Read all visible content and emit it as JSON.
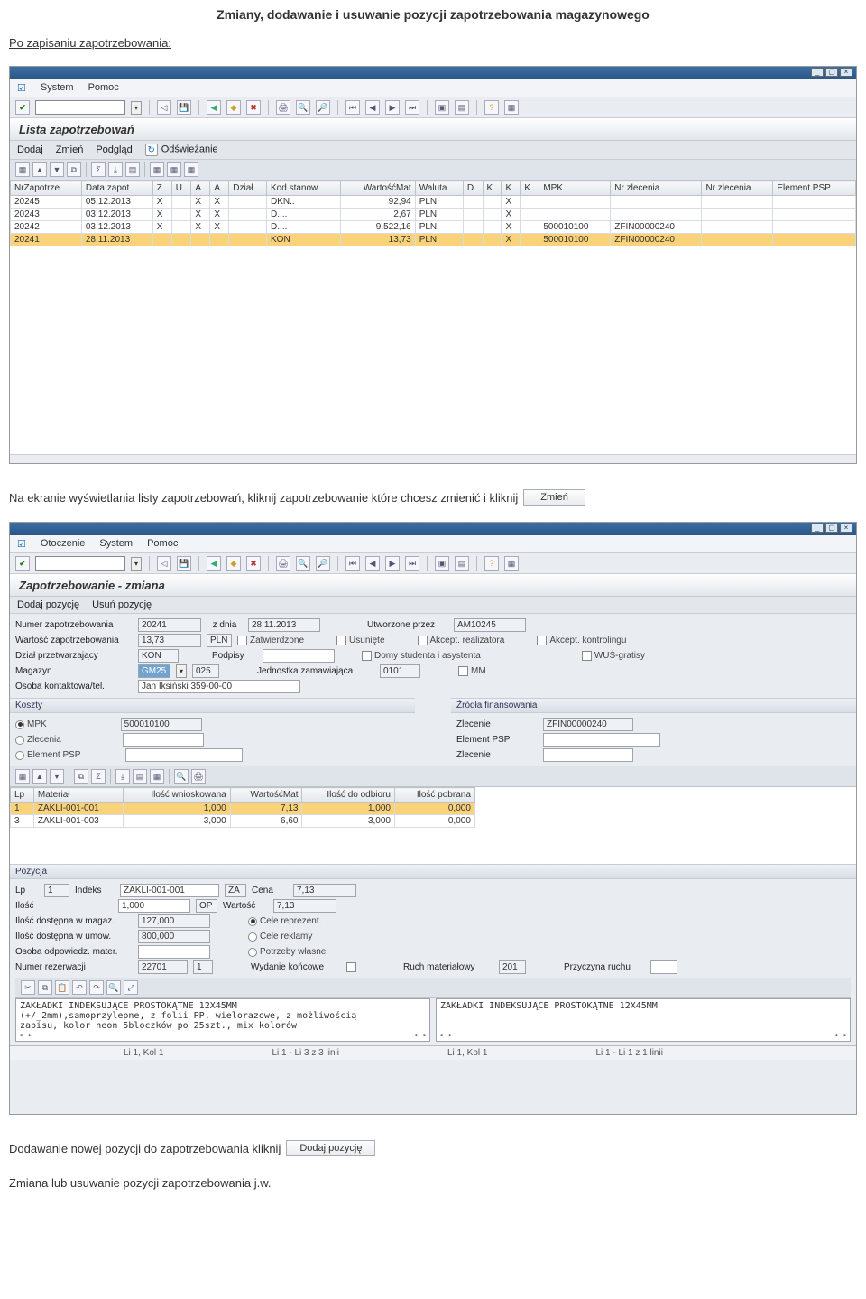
{
  "doc": {
    "title": "Zmiany, dodawanie i usuwanie pozycji zapotrzebowania magazynowego",
    "after_save": "Po zapisaniu zapotrzebowania:",
    "instr1": "Na ekranie wyświetlania listy zapotrzebowań, kliknij zapotrzebowanie które chcesz zmienić i kliknij",
    "zmien_btn": "Zmień",
    "instr2": "Dodawanie nowej pozycji do zapotrzebowania kliknij",
    "dodaj_btn": "Dodaj pozycję",
    "instr3": "Zmiana lub usuwanie pozycji zapotrzebowania j.w."
  },
  "sap1": {
    "menu": [
      "System",
      "Pomoc"
    ],
    "title": "Lista zapotrzebowań",
    "toolbar": [
      "Dodaj",
      "Zmień",
      "Podgląd",
      "Odświeżanie"
    ],
    "cols": [
      "NrZapotrze",
      "Data zapot",
      "Z",
      "U",
      "A",
      "A",
      "Dział",
      "Kod stanow",
      "WartośćMat",
      "Waluta",
      "D",
      "K",
      "K",
      "K",
      "MPK",
      "Nr zlecenia",
      "Nr zlecenia",
      "Element PSP"
    ],
    "rows": [
      {
        "nr": "20245",
        "data": "05.12.2013",
        "z": "X",
        "u": "",
        "a1": "X",
        "a2": "X",
        "dzial": "",
        "kod": "DKN..",
        "wart": "92,94",
        "wal": "PLN",
        "d": "",
        "k1": "",
        "k2": "X",
        "k3": "",
        "mpk": "",
        "zl1": "",
        "zl2": "",
        "psp": ""
      },
      {
        "nr": "20243",
        "data": "03.12.2013",
        "z": "X",
        "u": "",
        "a1": "X",
        "a2": "X",
        "dzial": "",
        "kod": "D....",
        "wart": "2,67",
        "wal": "PLN",
        "d": "",
        "k1": "",
        "k2": "X",
        "k3": "",
        "mpk": "",
        "zl1": "",
        "zl2": "",
        "psp": ""
      },
      {
        "nr": "20242",
        "data": "03.12.2013",
        "z": "X",
        "u": "",
        "a1": "X",
        "a2": "X",
        "dzial": "",
        "kod": "D....",
        "wart": "9.522,16",
        "wal": "PLN",
        "d": "",
        "k1": "",
        "k2": "X",
        "k3": "",
        "mpk": "500010100",
        "zl1": "ZFIN00000240",
        "zl2": "",
        "psp": ""
      },
      {
        "nr": "20241",
        "data": "28.11.2013",
        "z": "",
        "u": "",
        "a1": "",
        "a2": "",
        "dzial": "",
        "kod": "KON",
        "wart": "13,73",
        "wal": "PLN",
        "d": "",
        "k1": "",
        "k2": "X",
        "k3": "",
        "mpk": "500010100",
        "zl1": "ZFIN00000240",
        "zl2": "",
        "psp": "",
        "hl": true
      }
    ]
  },
  "sap2": {
    "menu": [
      "Otoczenie",
      "System",
      "Pomoc"
    ],
    "title": "Zapotrzebowanie - zmiana",
    "toolbar": [
      "Dodaj pozycję",
      "Usuń pozycję"
    ],
    "labels": {
      "numer": "Numer zapotrzebowania",
      "zdnia": "z dnia",
      "utworz": "Utworzone przez",
      "wartosc": "Wartość zapotrzebowania",
      "zatw": "Zatwierdzone",
      "usun": "Usunięte",
      "akc_r": "Akcept. realizatora",
      "akc_k": "Akcept. kontrolingu",
      "dzial": "Dział przetwarzający",
      "podpisy": "Podpisy",
      "domy": "Domy studenta i asystenta",
      "wus": "WUŚ-gratisy",
      "magazyn": "Magazyn",
      "jedn": "Jednostka zamawiająca",
      "mm": "MM",
      "osoba": "Osoba kontaktowa/tel.",
      "koszty": "Koszty",
      "zrodla": "Źródła finansowania",
      "mpk": "MPK",
      "zlecenia": "Zlecenia",
      "zlecenie": "Zlecenie",
      "element": "Element PSP",
      "pozycja": "Pozycja",
      "lp": "Lp",
      "indeks": "Indeks",
      "cena": "Cena",
      "ilosc": "Ilość",
      "wartosc2": "Wartość",
      "idm": "Ilość dostępna w magaz.",
      "cele_r": "Cele reprezent.",
      "idu": "Ilość dostępna w umow.",
      "cele_rek": "Cele reklamy",
      "oom": "Osoba odpowiedz. mater.",
      "potrzeby": "Potrzeby własne",
      "numer_r": "Numer rezerwacji",
      "wyd": "Wydanie końcowe",
      "ruch": "Ruch materiałowy",
      "przyczyna": "Przyczyna ruchu"
    },
    "vals": {
      "numer": "20241",
      "zdnia": "28.11.2013",
      "utworz": "AM10245",
      "wartosc": "13,73",
      "wal": "PLN",
      "dzial": "KON",
      "magazyn_a": "GM25",
      "magazyn_b": "025",
      "jedn": "0101",
      "osoba": "Jan Iksiński 359-00-00",
      "mpk": "500010100",
      "zlecenie": "ZFIN00000240",
      "lp": "1",
      "indeks": "ZAKLI-001-001",
      "indeks_sfx": "ZA",
      "cena": "7,13",
      "ilosc": "1,000",
      "ilosc_sfx": "OP",
      "wartosc2": "7,13",
      "idm": "127,000",
      "idu": "800,000",
      "rez1": "22701",
      "rez2": "1",
      "ruch": "201",
      "txt1a": "ZAKŁADKI INDEKSUJĄCE PROSTOKĄTNE 12X45MM",
      "txt1b": "(+/_2mm),samoprzylepne, z folii PP, wielorazowe, z możliwością",
      "txt1c": "zapisu, kolor neon 5bloczków po 25szt., mix kolorów",
      "txt2a": "ZAKŁADKI INDEKSUJĄCE PROSTOKĄTNE 12X45MM"
    },
    "items_cols": [
      "Lp",
      "Materiał",
      "Ilość wnioskowana",
      "WartośćMat",
      "Ilość do odbioru",
      "Ilość pobrana"
    ],
    "items": [
      {
        "lp": "1",
        "mat": "ZAKLI-001-001",
        "iw": "1,000",
        "wm": "7,13",
        "ido": "1,000",
        "ip": "0,000",
        "hl": true
      },
      {
        "lp": "3",
        "mat": "ZAKLI-001-003",
        "iw": "3,000",
        "wm": "6,60",
        "ido": "3,000",
        "ip": "0,000"
      }
    ],
    "status": [
      "Li 1, Kol 1",
      "Li 1 - Li 3 z 3 linii",
      "Li 1, Kol 1",
      "Li 1 - Li 1 z 1 linii"
    ]
  }
}
